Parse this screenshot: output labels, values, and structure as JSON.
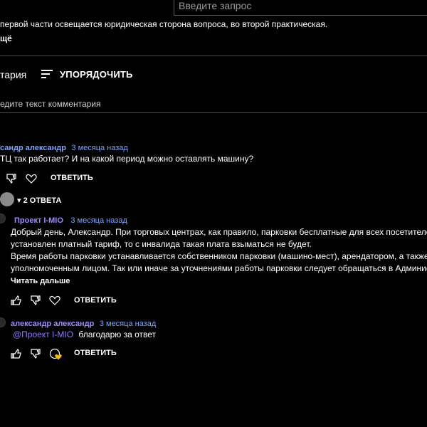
{
  "search": {
    "placeholder": "Введите запрос"
  },
  "video": {
    "description": "первой части освещается юридическая сторона вопроса, во второй практическая.",
    "more_label": "щё"
  },
  "comments_header": {
    "count_label": "тария",
    "sort_label": "УПОРЯДОЧИТЬ",
    "input_placeholder": "едите текст комментария"
  },
  "comment": {
    "author": "сандр александр",
    "time": "3 месяца назад",
    "text": "ТЦ так работает? И на какой период можно оставлять машину?",
    "reply_label": "ОТВЕТИТЬ"
  },
  "replies_toggle": {
    "label": "2 ОТВЕТА"
  },
  "replies": [
    {
      "author": "Проект I-MIO",
      "time": "3 месяца назад",
      "lines": [
        "Добрый день, Александр. При торговых центрах, как правило, парковки бесплатные для всех посетителей",
        "установлен платный тариф, то с инвалида такая плата  взыматься не будет.",
        "Время работы парковки устанавливается собственником парковки (машино-мест), арендатором, а также д",
        "уполномоченным лицом. Так или иначе за уточнениями работы парковки следует обращаться в Админист"
      ],
      "read_more": "Читать дальше",
      "reply_label": "ОТВЕТИТЬ"
    },
    {
      "author": "александр александр",
      "time": "3 месяца назад",
      "mention": "@Проект I-MIO",
      "text": "благодарю за ответ",
      "reply_label": "ОТВЕТИТЬ"
    }
  ],
  "icons": {
    "like": "thumbs-up-icon",
    "dislike": "thumbs-down-icon",
    "heart": "heart-icon",
    "hearted": "creator-heart-icon",
    "sort": "sort-icon"
  },
  "colors": {
    "link": "#7aa6ff",
    "mention": "#8c7cff",
    "heart": "#f2c200"
  }
}
